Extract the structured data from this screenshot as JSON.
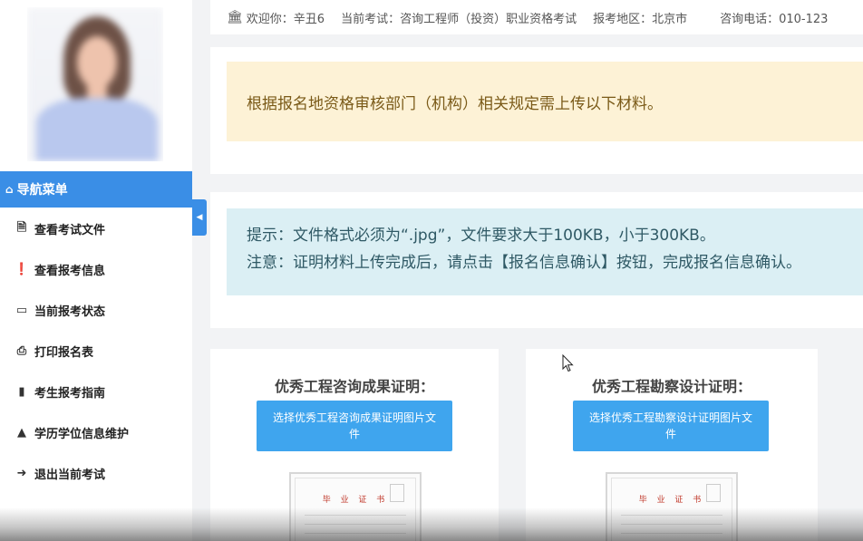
{
  "topbar": {
    "welcome": "欢迎你：辛丑6",
    "exam": "当前考试：咨询工程师（投资）职业资格考试",
    "region": "报考地区：北京市",
    "phone": "咨询电话：010-123"
  },
  "sidebar": {
    "header": "导航菜单",
    "items": [
      {
        "label": "查看考试文件",
        "icon": "file-icon"
      },
      {
        "label": "查看报考信息",
        "icon": "info-icon"
      },
      {
        "label": "当前报考状态",
        "icon": "monitor-icon"
      },
      {
        "label": "打印报名表",
        "icon": "print-icon"
      },
      {
        "label": "考生报考指南",
        "icon": "book-icon"
      },
      {
        "label": "学历学位信息维护",
        "icon": "graduation-cap-icon"
      },
      {
        "label": "退出当前考试",
        "icon": "sign-out-icon"
      }
    ]
  },
  "notices": {
    "warning": "根据报名地资格审核部门（机构）相关规定需上传以下材料。",
    "tip_line1": "提示：文件格式必须为“.jpg”，文件要求大于100KB，小于300KB。",
    "tip_line2": "注意：证明材料上传完成后，请点击【报名信息确认】按钮，完成报名信息确认。"
  },
  "cards": [
    {
      "title": "优秀工程咨询成果证明：",
      "button": "选择优秀工程咨询成果证明图片文件",
      "cert_title": "毕 业 证 书"
    },
    {
      "title": "优秀工程勘察设计证明：",
      "button": "选择优秀工程勘察设计证明图片文件",
      "cert_title": "毕 业 证 书"
    }
  ],
  "colors": {
    "accent": "#3a8ee6",
    "button": "#3fa5ee",
    "warning_bg": "#fdf2d6",
    "info_bg": "#dbeff4"
  }
}
